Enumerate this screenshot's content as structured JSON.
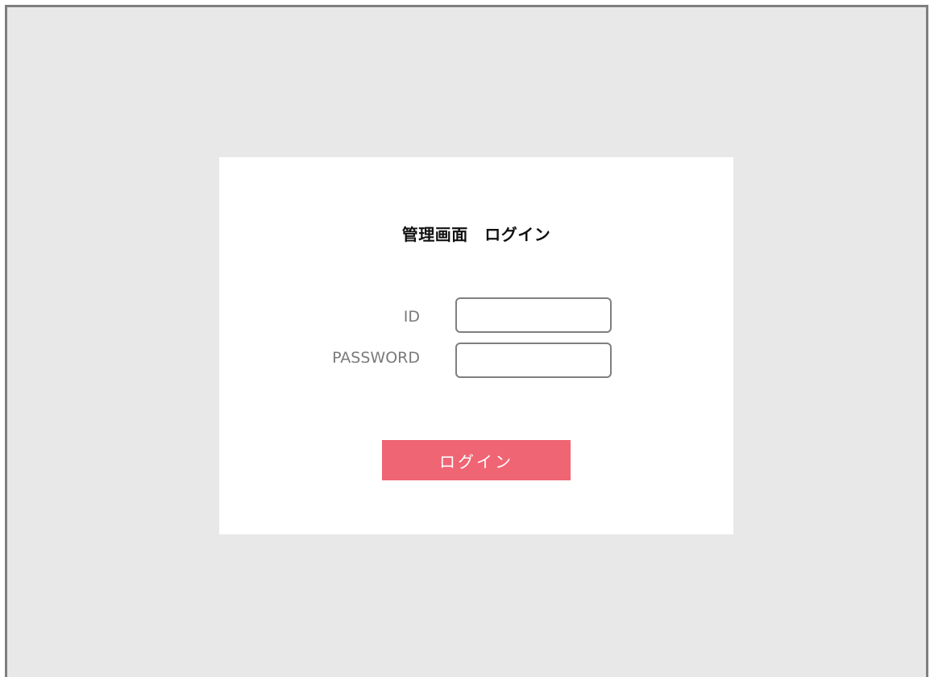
{
  "login": {
    "title": "管理画面　ログイン",
    "id_label": "ID",
    "id_value": "",
    "password_label": "PASSWORD",
    "password_value": "",
    "submit_label": "ログイン"
  },
  "colors": {
    "background": "#e8e8e8",
    "frame_border": "#7f7f7f",
    "card": "#ffffff",
    "label_text": "#7a7a7a",
    "button": "#ef6574",
    "button_text": "#ffffff"
  }
}
